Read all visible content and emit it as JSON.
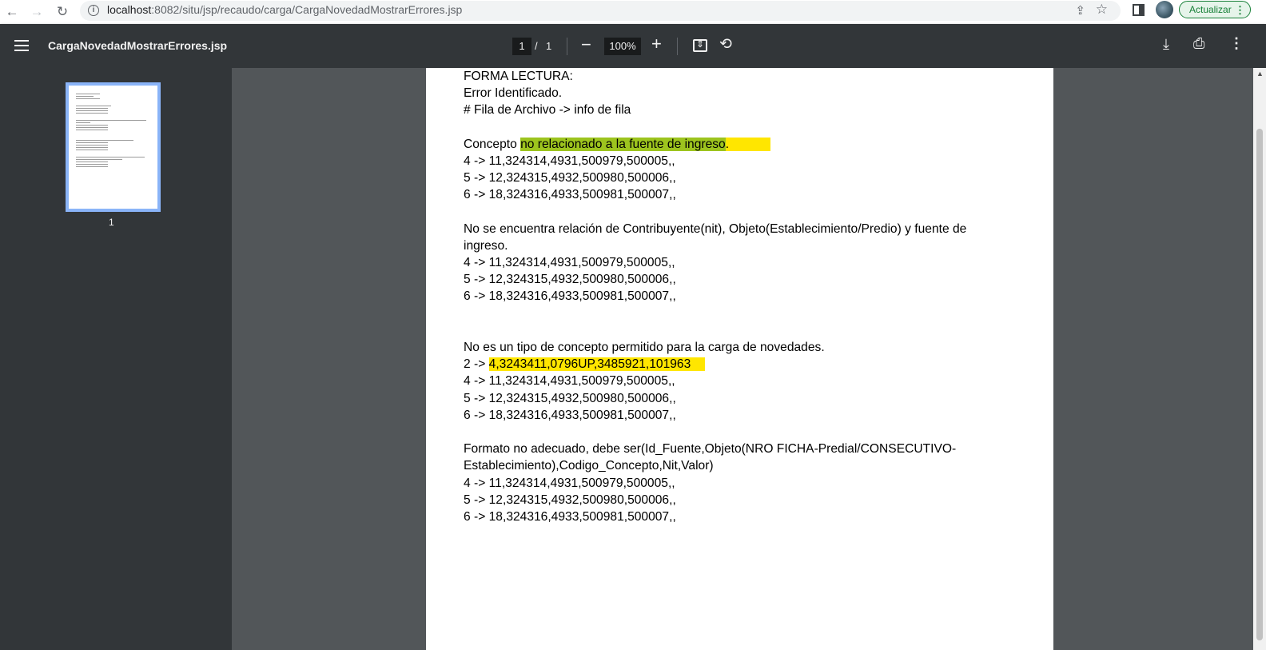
{
  "browser": {
    "back_icon": "←",
    "forward_icon": "→",
    "reload_icon": "↻",
    "url_host": "localhost",
    "url_rest": ":8082/situ/jsp/recaudo/carga/CargaNovedadMostrarErrores.jsp",
    "update_label": "Actualizar"
  },
  "toolbar": {
    "title": "CargaNovedadMostrarErrores.jsp",
    "current_page": "1",
    "page_separator": "/",
    "total_pages": "1",
    "zoom_out": "−",
    "zoom": "100%",
    "zoom_in": "+",
    "rotate_icon": "⟲",
    "download_icon": "⤓",
    "print_icon": "⎙",
    "more_icon": "⋮"
  },
  "sidebar": {
    "thumbnail_label": "1"
  },
  "document": {
    "header": [
      "FORMA LECTURA:",
      "Error Identificado.",
      "# Fila de Archivo -> info de fila"
    ],
    "section1": {
      "title_pre": "Concepto ",
      "title_hl_green": "no relacionado a la fuente de ingreso",
      "title_post": ".",
      "rows": [
        "4 -> 11,324314,4931,500979,500005,,",
        "5 -> 12,324315,4932,500980,500006,,",
        "6 -> 18,324316,4933,500981,500007,,"
      ]
    },
    "section2": {
      "title_line1": "No se encuentra relación de Contribuyente(nit), Objeto(Establecimiento/Predio) y fuente de",
      "title_line2": "ingreso.",
      "rows": [
        "4 -> 11,324314,4931,500979,500005,,",
        "5 -> 12,324315,4932,500980,500006,,",
        "6 -> 18,324316,4933,500981,500007,,"
      ]
    },
    "section3": {
      "title": "No es un tipo de concepto permitido para la carga de novedades.",
      "row_hl_prefix": "2 -> ",
      "row_hl_value": "4,3243411,0796UP,3485921,101963",
      "rows": [
        "4 -> 11,324314,4931,500979,500005,,",
        "5 -> 12,324315,4932,500980,500006,,",
        "6 -> 18,324316,4933,500981,500007,,"
      ]
    },
    "section4": {
      "title_line1": "Formato no adecuado, debe ser(Id_Fuente,Objeto(NRO FICHA-Predial/CONSECUTIVO-",
      "title_line2": "Establecimiento),Codigo_Concepto,Nit,Valor)",
      "rows": [
        "4 -> 11,324314,4931,500979,500005,,",
        "5 -> 12,324315,4932,500980,500006,,",
        "6 -> 18,324316,4933,500981,500007,,"
      ]
    }
  },
  "colors": {
    "highlight_yellow": "#ffe600",
    "highlight_green": "#9dc41e",
    "viewer_bg": "#525659",
    "toolbar_bg": "#323639"
  }
}
